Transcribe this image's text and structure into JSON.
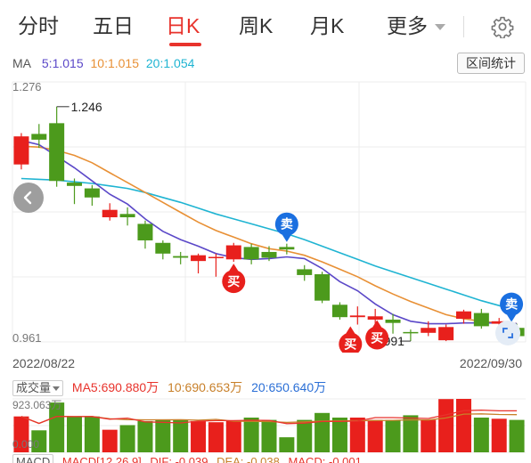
{
  "tabs": [
    {
      "label": "分时",
      "active": false
    },
    {
      "label": "五日",
      "active": false
    },
    {
      "label": "日K",
      "active": true
    },
    {
      "label": "周K",
      "active": false
    },
    {
      "label": "月K",
      "active": false
    },
    {
      "label": "更多",
      "active": false
    }
  ],
  "settings_icon": "gear-icon",
  "ma_legend": {
    "label": "MA",
    "ma5": "5:1.015",
    "ma10": "10:1.015",
    "ma20": "20:1.054",
    "colors": {
      "ma5": "#5b48c8",
      "ma10": "#e89035",
      "ma20": "#1fb4d2"
    }
  },
  "range_stats_button": "区间统计",
  "price_axis": {
    "top": "1.276",
    "bottom": "0.961"
  },
  "annotations": {
    "high": "1.246",
    "low": "0.991"
  },
  "signals": {
    "buy": "买",
    "sell": "卖"
  },
  "dates": {
    "start": "2022/08/22",
    "end": "2022/09/30"
  },
  "volume_panel": {
    "selector": "成交量",
    "ma5": "MA5:690.880万",
    "ma10": "10:690.653万",
    "ma20": "20:650.640万",
    "max": "923.063万",
    "min": "0.000"
  },
  "macd_panel": {
    "selector": "MACD",
    "params": "MACD[12,26,9]",
    "dif": "DIF: -0.039",
    "dea": "DEA: -0.038",
    "macd": "MACD: -0.001"
  },
  "colors": {
    "up": "#e8201c",
    "down": "#4c9a1c",
    "accent": "#e8332c",
    "sell_badge": "#1a6fe0"
  },
  "chart_data": {
    "type": "candlestick",
    "ylim": [
      0.961,
      1.276
    ],
    "candles": [
      {
        "o": 1.176,
        "c": 1.21,
        "h": 1.214,
        "l": 1.17
      },
      {
        "o": 1.213,
        "c": 1.206,
        "h": 1.225,
        "l": 1.196
      },
      {
        "o": 1.226,
        "c": 1.156,
        "h": 1.246,
        "l": 1.149
      },
      {
        "o": 1.154,
        "c": 1.15,
        "h": 1.159,
        "l": 1.128
      },
      {
        "o": 1.147,
        "c": 1.136,
        "h": 1.151,
        "l": 1.126
      },
      {
        "o": 1.112,
        "c": 1.121,
        "h": 1.129,
        "l": 1.108
      },
      {
        "o": 1.116,
        "c": 1.112,
        "h": 1.124,
        "l": 1.102
      },
      {
        "o": 1.104,
        "c": 1.084,
        "h": 1.108,
        "l": 1.074
      },
      {
        "o": 1.081,
        "c": 1.068,
        "h": 1.084,
        "l": 1.061
      },
      {
        "o": 1.065,
        "c": 1.063,
        "h": 1.07,
        "l": 1.055
      },
      {
        "o": 1.059,
        "c": 1.066,
        "h": 1.068,
        "l": 1.044
      },
      {
        "o": 1.063,
        "c": 1.064,
        "h": 1.068,
        "l": 1.04
      },
      {
        "o": 1.061,
        "c": 1.078,
        "h": 1.081,
        "l": 1.058
      },
      {
        "o": 1.076,
        "c": 1.061,
        "h": 1.08,
        "l": 1.055
      },
      {
        "o": 1.07,
        "c": 1.063,
        "h": 1.077,
        "l": 1.059
      },
      {
        "o": 1.076,
        "c": 1.073,
        "h": 1.08,
        "l": 1.067
      },
      {
        "o": 1.049,
        "c": 1.042,
        "h": 1.054,
        "l": 1.035
      },
      {
        "o": 1.043,
        "c": 1.011,
        "h": 1.046,
        "l": 1.008
      },
      {
        "o": 1.006,
        "c": 0.991,
        "h": 1.009,
        "l": 0.988
      },
      {
        "o": 0.991,
        "c": 0.993,
        "h": 1.004,
        "l": 0.982
      },
      {
        "o": 0.988,
        "c": 0.992,
        "h": 1.001,
        "l": 0.981
      },
      {
        "o": 0.988,
        "c": 0.984,
        "h": 0.995,
        "l": 0.971
      },
      {
        "o": 0.973,
        "c": 0.972,
        "h": 0.976,
        "l": 0.962
      },
      {
        "o": 0.972,
        "c": 0.978,
        "h": 0.986,
        "l": 0.968
      },
      {
        "o": 0.963,
        "c": 0.979,
        "h": 0.982,
        "l": 0.962
      },
      {
        "o": 0.989,
        "c": 0.998,
        "h": 1.0,
        "l": 0.983
      },
      {
        "o": 0.996,
        "c": 0.98,
        "h": 1.001,
        "l": 0.977
      },
      {
        "o": 0.983,
        "c": 0.986,
        "h": 0.99,
        "l": 0.978
      },
      {
        "o": 0.978,
        "c": 0.968,
        "h": 0.983,
        "l": 0.966
      }
    ],
    "ma5": [
      1.205,
      1.2,
      1.186,
      1.172,
      1.156,
      1.14,
      1.128,
      1.11,
      1.095,
      1.085,
      1.077,
      1.068,
      1.063,
      1.061,
      1.062,
      1.064,
      1.062,
      1.05,
      1.034,
      1.023,
      1.007,
      0.994,
      0.986,
      0.983,
      0.983,
      0.984,
      0.984,
      0.984,
      0.983
    ],
    "ma10": [
      1.198,
      1.197,
      1.193,
      1.187,
      1.178,
      1.166,
      1.154,
      1.142,
      1.13,
      1.118,
      1.106,
      1.096,
      1.088,
      1.08,
      1.074,
      1.071,
      1.066,
      1.058,
      1.049,
      1.04,
      1.029,
      1.019,
      1.01,
      1.002,
      0.994,
      0.989,
      0.986,
      0.984,
      0.983
    ],
    "ma20": [
      1.159,
      1.158,
      1.157,
      1.155,
      1.153,
      1.15,
      1.147,
      1.142,
      1.136,
      1.13,
      1.123,
      1.116,
      1.11,
      1.104,
      1.098,
      1.092,
      1.085,
      1.077,
      1.069,
      1.061,
      1.053,
      1.046,
      1.039,
      1.032,
      1.025,
      1.018,
      1.011,
      1.005,
      0.999
    ],
    "sell_markers": [
      15,
      28
    ],
    "buy_markers": [
      12,
      19,
      20
    ],
    "volume": {
      "ylim": [
        0,
        923.063
      ],
      "values": [
        620,
        380,
        860,
        610,
        620,
        390,
        470,
        540,
        570,
        570,
        540,
        520,
        540,
        600,
        560,
        260,
        560,
        680,
        600,
        600,
        560,
        560,
        640,
        560,
        920,
        923,
        600,
        580,
        560
      ]
    }
  }
}
